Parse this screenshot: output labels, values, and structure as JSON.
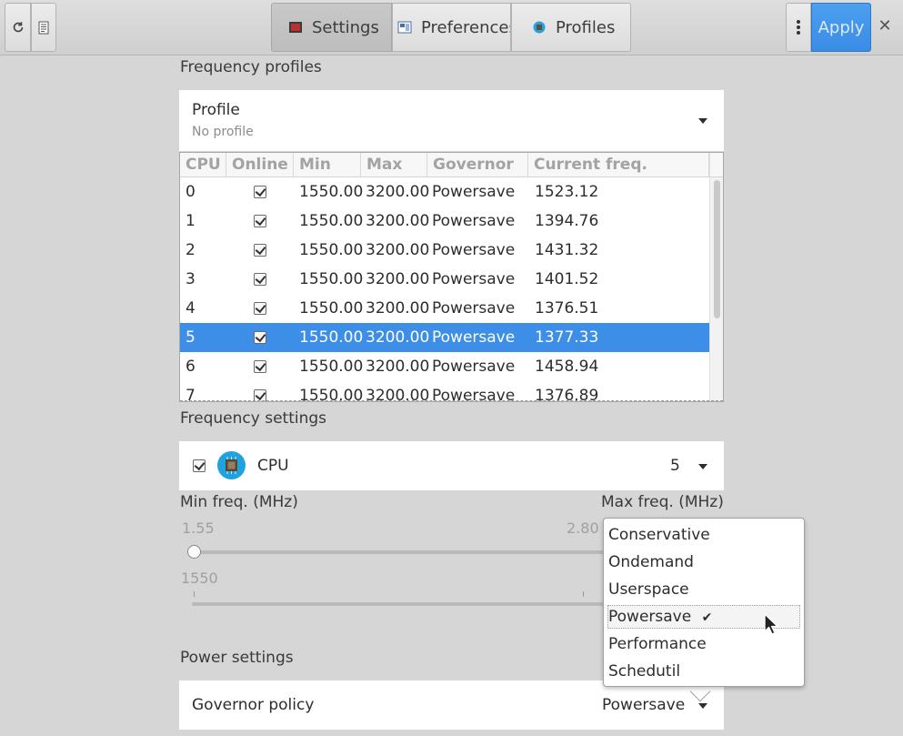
{
  "toolbar": {
    "refresh_icon": "refresh-icon",
    "log_icon": "document-icon",
    "tabs": [
      {
        "label": "Settings",
        "icon": "settings-tab-icon",
        "active": true
      },
      {
        "label": "Preferences",
        "icon": "preferences-tab-icon",
        "active": false
      },
      {
        "label": "Profiles",
        "icon": "profiles-tab-icon",
        "active": false
      }
    ],
    "menu_icon": "kebab-menu-icon",
    "apply_label": "Apply",
    "close_icon": "close-icon",
    "accent_color": "#3d8ee6"
  },
  "frequency_profiles": {
    "title": "Frequency profiles",
    "profile_label": "Profile",
    "profile_value": "No profile"
  },
  "cpu_table": {
    "columns": [
      "CPU",
      "Online",
      "Min",
      "Max",
      "Governor",
      "Current freq."
    ],
    "selected_row": 5,
    "rows": [
      {
        "cpu": "0",
        "online": true,
        "min": "1550.00",
        "max": "3200.00",
        "governor": "Powersave",
        "current": "1523.12"
      },
      {
        "cpu": "1",
        "online": true,
        "min": "1550.00",
        "max": "3200.00",
        "governor": "Powersave",
        "current": "1394.76"
      },
      {
        "cpu": "2",
        "online": true,
        "min": "1550.00",
        "max": "3200.00",
        "governor": "Powersave",
        "current": "1431.32"
      },
      {
        "cpu": "3",
        "online": true,
        "min": "1550.00",
        "max": "3200.00",
        "governor": "Powersave",
        "current": "1401.52"
      },
      {
        "cpu": "4",
        "online": true,
        "min": "1550.00",
        "max": "3200.00",
        "governor": "Powersave",
        "current": "1376.51"
      },
      {
        "cpu": "5",
        "online": true,
        "min": "1550.00",
        "max": "3200.00",
        "governor": "Powersave",
        "current": "1377.33"
      },
      {
        "cpu": "6",
        "online": true,
        "min": "1550.00",
        "max": "3200.00",
        "governor": "Powersave",
        "current": "1458.94"
      },
      {
        "cpu": "7",
        "online": true,
        "min": "1550.00",
        "max": "3200.00",
        "governor": "Powersave",
        "current": "1376.89"
      }
    ]
  },
  "frequency_settings": {
    "title": "Frequency settings",
    "cpu_label": "CPU",
    "cpu_icon": "cpu-chip-icon",
    "cpu_value": "5",
    "min_label": "Min freq. (MHz)",
    "max_label": "Max freq. (MHz)",
    "scale_start": "1.55",
    "scale_mid": "2.80",
    "min_value": "1550",
    "min_slider_fraction": 0.0
  },
  "governor_menu": {
    "items": [
      "Conservative",
      "Ondemand",
      "Userspace",
      "Powersave",
      "Performance",
      "Schedutil"
    ],
    "selected": "Powersave",
    "check_icon": "checkmark-icon"
  },
  "power_settings": {
    "title": "Power settings",
    "governor_label": "Governor policy",
    "governor_value": "Powersave"
  }
}
